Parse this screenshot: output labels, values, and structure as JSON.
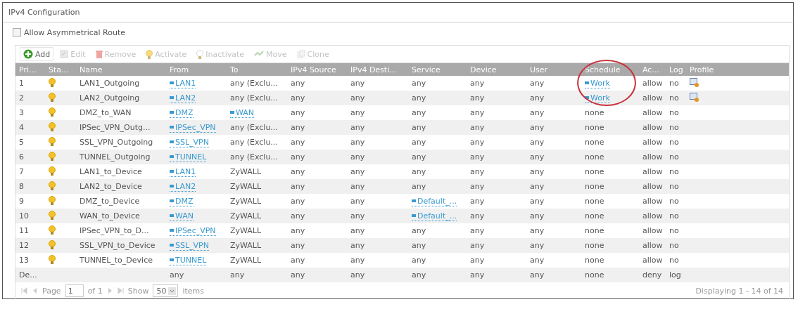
{
  "panel": {
    "title": "IPv4 Configuration"
  },
  "asymmetrical_route": {
    "label": "Allow Asymmetrical Route",
    "checked": false
  },
  "toolbar": [
    {
      "label": "Add",
      "kind": "add",
      "disabled": false
    },
    {
      "label": "Edit",
      "kind": "edit",
      "disabled": true
    },
    {
      "label": "Remove",
      "kind": "remove",
      "disabled": true
    },
    {
      "label": "Activate",
      "kind": "activate",
      "disabled": true
    },
    {
      "label": "Inactivate",
      "kind": "inactivate",
      "disabled": true
    },
    {
      "label": "Move",
      "kind": "move",
      "disabled": true
    },
    {
      "label": "Clone",
      "kind": "clone",
      "disabled": true
    }
  ],
  "table": {
    "columns": [
      {
        "label": "Pri...",
        "circled": false
      },
      {
        "label": "Sta...",
        "circled": false
      },
      {
        "label": "Name",
        "circled": false
      },
      {
        "label": "From",
        "circled": false
      },
      {
        "label": "To",
        "circled": false
      },
      {
        "label": "IPv4 Source",
        "circled": false
      },
      {
        "label": "IPv4 Desti...",
        "circled": false
      },
      {
        "label": "Service",
        "circled": false
      },
      {
        "label": "Device",
        "circled": false
      },
      {
        "label": "User",
        "circled": false
      },
      {
        "label": "Schedule",
        "circled": true
      },
      {
        "label": "Ac...",
        "circled": false
      },
      {
        "label": "Log",
        "circled": false
      },
      {
        "label": "Profile",
        "circled": false
      }
    ],
    "rows": [
      {
        "cells": [
          {
            "kind": "text",
            "text": "1"
          },
          {
            "kind": "bulb"
          },
          {
            "kind": "text",
            "text": "LAN1_Outgoing"
          },
          {
            "kind": "link",
            "text": "LAN1"
          },
          {
            "kind": "text",
            "text": "any (Exclu..."
          },
          {
            "kind": "text",
            "text": "any"
          },
          {
            "kind": "text",
            "text": "any"
          },
          {
            "kind": "text",
            "text": "any"
          },
          {
            "kind": "text",
            "text": "any"
          },
          {
            "kind": "text",
            "text": "any"
          },
          {
            "kind": "link",
            "text": "Work"
          },
          {
            "kind": "text",
            "text": "allow"
          },
          {
            "kind": "text",
            "text": "no"
          },
          {
            "kind": "profile"
          }
        ]
      },
      {
        "cells": [
          {
            "kind": "text",
            "text": "2"
          },
          {
            "kind": "bulb"
          },
          {
            "kind": "text",
            "text": "LAN2_Outgoing"
          },
          {
            "kind": "link",
            "text": "LAN2"
          },
          {
            "kind": "text",
            "text": "any (Exclu..."
          },
          {
            "kind": "text",
            "text": "any"
          },
          {
            "kind": "text",
            "text": "any"
          },
          {
            "kind": "text",
            "text": "any"
          },
          {
            "kind": "text",
            "text": "any"
          },
          {
            "kind": "text",
            "text": "any"
          },
          {
            "kind": "link",
            "text": "Work"
          },
          {
            "kind": "text",
            "text": "allow"
          },
          {
            "kind": "text",
            "text": "no"
          },
          {
            "kind": "profile"
          }
        ]
      },
      {
        "cells": [
          {
            "kind": "text",
            "text": "3"
          },
          {
            "kind": "bulb"
          },
          {
            "kind": "text",
            "text": "DMZ_to_WAN"
          },
          {
            "kind": "link",
            "text": "DMZ"
          },
          {
            "kind": "link",
            "text": "WAN"
          },
          {
            "kind": "text",
            "text": "any"
          },
          {
            "kind": "text",
            "text": "any"
          },
          {
            "kind": "text",
            "text": "any"
          },
          {
            "kind": "text",
            "text": "any"
          },
          {
            "kind": "text",
            "text": "any"
          },
          {
            "kind": "text",
            "text": "none"
          },
          {
            "kind": "text",
            "text": "allow"
          },
          {
            "kind": "text",
            "text": "no"
          },
          {
            "kind": "text",
            "text": ""
          }
        ]
      },
      {
        "cells": [
          {
            "kind": "text",
            "text": "4"
          },
          {
            "kind": "bulb"
          },
          {
            "kind": "text",
            "text": "IPSec_VPN_Outg..."
          },
          {
            "kind": "link",
            "text": "IPSec_VPN"
          },
          {
            "kind": "text",
            "text": "any (Exclu..."
          },
          {
            "kind": "text",
            "text": "any"
          },
          {
            "kind": "text",
            "text": "any"
          },
          {
            "kind": "text",
            "text": "any"
          },
          {
            "kind": "text",
            "text": "any"
          },
          {
            "kind": "text",
            "text": "any"
          },
          {
            "kind": "text",
            "text": "none"
          },
          {
            "kind": "text",
            "text": "allow"
          },
          {
            "kind": "text",
            "text": "no"
          },
          {
            "kind": "text",
            "text": ""
          }
        ]
      },
      {
        "cells": [
          {
            "kind": "text",
            "text": "5"
          },
          {
            "kind": "bulb"
          },
          {
            "kind": "text",
            "text": "SSL_VPN_Outgoing"
          },
          {
            "kind": "link",
            "text": "SSL_VPN"
          },
          {
            "kind": "text",
            "text": "any (Exclu..."
          },
          {
            "kind": "text",
            "text": "any"
          },
          {
            "kind": "text",
            "text": "any"
          },
          {
            "kind": "text",
            "text": "any"
          },
          {
            "kind": "text",
            "text": "any"
          },
          {
            "kind": "text",
            "text": "any"
          },
          {
            "kind": "text",
            "text": "none"
          },
          {
            "kind": "text",
            "text": "allow"
          },
          {
            "kind": "text",
            "text": "no"
          },
          {
            "kind": "text",
            "text": ""
          }
        ]
      },
      {
        "cells": [
          {
            "kind": "text",
            "text": "6"
          },
          {
            "kind": "bulb"
          },
          {
            "kind": "text",
            "text": "TUNNEL_Outgoing"
          },
          {
            "kind": "link",
            "text": "TUNNEL"
          },
          {
            "kind": "text",
            "text": "any (Exclu..."
          },
          {
            "kind": "text",
            "text": "any"
          },
          {
            "kind": "text",
            "text": "any"
          },
          {
            "kind": "text",
            "text": "any"
          },
          {
            "kind": "text",
            "text": "any"
          },
          {
            "kind": "text",
            "text": "any"
          },
          {
            "kind": "text",
            "text": "none"
          },
          {
            "kind": "text",
            "text": "allow"
          },
          {
            "kind": "text",
            "text": "no"
          },
          {
            "kind": "text",
            "text": ""
          }
        ]
      },
      {
        "cells": [
          {
            "kind": "text",
            "text": "7"
          },
          {
            "kind": "bulb"
          },
          {
            "kind": "text",
            "text": "LAN1_to_Device"
          },
          {
            "kind": "link",
            "text": "LAN1"
          },
          {
            "kind": "text",
            "text": "ZyWALL"
          },
          {
            "kind": "text",
            "text": "any"
          },
          {
            "kind": "text",
            "text": "any"
          },
          {
            "kind": "text",
            "text": "any"
          },
          {
            "kind": "text",
            "text": "any"
          },
          {
            "kind": "text",
            "text": "any"
          },
          {
            "kind": "text",
            "text": "none"
          },
          {
            "kind": "text",
            "text": "allow"
          },
          {
            "kind": "text",
            "text": "no"
          },
          {
            "kind": "text",
            "text": ""
          }
        ]
      },
      {
        "cells": [
          {
            "kind": "text",
            "text": "8"
          },
          {
            "kind": "bulb"
          },
          {
            "kind": "text",
            "text": "LAN2_to_Device"
          },
          {
            "kind": "link",
            "text": "LAN2"
          },
          {
            "kind": "text",
            "text": "ZyWALL"
          },
          {
            "kind": "text",
            "text": "any"
          },
          {
            "kind": "text",
            "text": "any"
          },
          {
            "kind": "text",
            "text": "any"
          },
          {
            "kind": "text",
            "text": "any"
          },
          {
            "kind": "text",
            "text": "any"
          },
          {
            "kind": "text",
            "text": "none"
          },
          {
            "kind": "text",
            "text": "allow"
          },
          {
            "kind": "text",
            "text": "no"
          },
          {
            "kind": "text",
            "text": ""
          }
        ]
      },
      {
        "cells": [
          {
            "kind": "text",
            "text": "9"
          },
          {
            "kind": "bulb"
          },
          {
            "kind": "text",
            "text": "DMZ_to_Device"
          },
          {
            "kind": "link",
            "text": "DMZ"
          },
          {
            "kind": "text",
            "text": "ZyWALL"
          },
          {
            "kind": "text",
            "text": "any"
          },
          {
            "kind": "text",
            "text": "any"
          },
          {
            "kind": "link",
            "text": "Default_..."
          },
          {
            "kind": "text",
            "text": "any"
          },
          {
            "kind": "text",
            "text": "any"
          },
          {
            "kind": "text",
            "text": "none"
          },
          {
            "kind": "text",
            "text": "allow"
          },
          {
            "kind": "text",
            "text": "no"
          },
          {
            "kind": "text",
            "text": ""
          }
        ]
      },
      {
        "cells": [
          {
            "kind": "text",
            "text": "10"
          },
          {
            "kind": "bulb"
          },
          {
            "kind": "text",
            "text": "WAN_to_Device"
          },
          {
            "kind": "link",
            "text": "WAN"
          },
          {
            "kind": "text",
            "text": "ZyWALL"
          },
          {
            "kind": "text",
            "text": "any"
          },
          {
            "kind": "text",
            "text": "any"
          },
          {
            "kind": "link",
            "text": "Default_..."
          },
          {
            "kind": "text",
            "text": "any"
          },
          {
            "kind": "text",
            "text": "any"
          },
          {
            "kind": "text",
            "text": "none"
          },
          {
            "kind": "text",
            "text": "allow"
          },
          {
            "kind": "text",
            "text": "no"
          },
          {
            "kind": "text",
            "text": ""
          }
        ]
      },
      {
        "cells": [
          {
            "kind": "text",
            "text": "11"
          },
          {
            "kind": "bulb"
          },
          {
            "kind": "text",
            "text": "IPSec_VPN_to_D..."
          },
          {
            "kind": "link",
            "text": "IPSec_VPN"
          },
          {
            "kind": "text",
            "text": "ZyWALL"
          },
          {
            "kind": "text",
            "text": "any"
          },
          {
            "kind": "text",
            "text": "any"
          },
          {
            "kind": "text",
            "text": "any"
          },
          {
            "kind": "text",
            "text": "any"
          },
          {
            "kind": "text",
            "text": "any"
          },
          {
            "kind": "text",
            "text": "none"
          },
          {
            "kind": "text",
            "text": "allow"
          },
          {
            "kind": "text",
            "text": "no"
          },
          {
            "kind": "text",
            "text": ""
          }
        ]
      },
      {
        "cells": [
          {
            "kind": "text",
            "text": "12"
          },
          {
            "kind": "bulb"
          },
          {
            "kind": "text",
            "text": "SSL_VPN_to_Device"
          },
          {
            "kind": "link",
            "text": "SSL_VPN"
          },
          {
            "kind": "text",
            "text": "ZyWALL"
          },
          {
            "kind": "text",
            "text": "any"
          },
          {
            "kind": "text",
            "text": "any"
          },
          {
            "kind": "text",
            "text": "any"
          },
          {
            "kind": "text",
            "text": "any"
          },
          {
            "kind": "text",
            "text": "any"
          },
          {
            "kind": "text",
            "text": "none"
          },
          {
            "kind": "text",
            "text": "allow"
          },
          {
            "kind": "text",
            "text": "no"
          },
          {
            "kind": "text",
            "text": ""
          }
        ]
      },
      {
        "cells": [
          {
            "kind": "text",
            "text": "13"
          },
          {
            "kind": "bulb"
          },
          {
            "kind": "text",
            "text": "TUNNEL_to_Device"
          },
          {
            "kind": "link",
            "text": "TUNNEL"
          },
          {
            "kind": "text",
            "text": "ZyWALL"
          },
          {
            "kind": "text",
            "text": "any"
          },
          {
            "kind": "text",
            "text": "any"
          },
          {
            "kind": "text",
            "text": "any"
          },
          {
            "kind": "text",
            "text": "any"
          },
          {
            "kind": "text",
            "text": "any"
          },
          {
            "kind": "text",
            "text": "none"
          },
          {
            "kind": "text",
            "text": "allow"
          },
          {
            "kind": "text",
            "text": "no"
          },
          {
            "kind": "text",
            "text": ""
          }
        ]
      },
      {
        "cells": [
          {
            "kind": "text",
            "text": "De..."
          },
          {
            "kind": "text",
            "text": ""
          },
          {
            "kind": "text",
            "text": ""
          },
          {
            "kind": "text",
            "text": "any"
          },
          {
            "kind": "text",
            "text": "any"
          },
          {
            "kind": "text",
            "text": "any"
          },
          {
            "kind": "text",
            "text": "any"
          },
          {
            "kind": "text",
            "text": "any"
          },
          {
            "kind": "text",
            "text": "any"
          },
          {
            "kind": "text",
            "text": "any"
          },
          {
            "kind": "text",
            "text": "none"
          },
          {
            "kind": "text",
            "text": "deny"
          },
          {
            "kind": "text",
            "text": "log"
          },
          {
            "kind": "text",
            "text": ""
          }
        ]
      }
    ]
  },
  "pager": {
    "page_label": "Page",
    "page": "1",
    "of_label": "of 1",
    "show_label": "Show",
    "page_size": "50",
    "items_label": "items",
    "summary": "Displaying 1 - 14 of 14"
  }
}
